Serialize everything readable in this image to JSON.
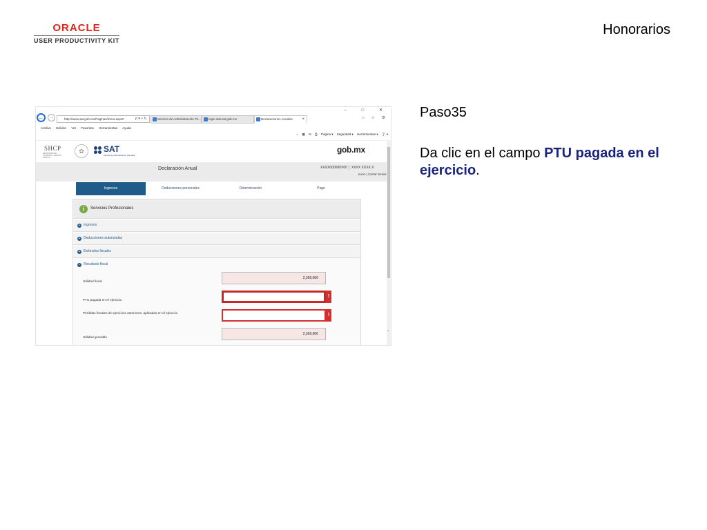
{
  "header": {
    "brand": "ORACLE",
    "brand_sub": "USER PRODUCTIVITY KIT",
    "title": "Honorarios"
  },
  "instruction": {
    "step": "Paso35",
    "prefix": "Da clic en el campo ",
    "highlight": "PTU pagada en el ejercicio",
    "suffix": "."
  },
  "browser": {
    "address": "http://www.sat.gob.mx/Paginas/Inicio.aspx#",
    "address_controls": "ρ ▾ » ↻",
    "tabs": [
      {
        "label": "Servicio de Administración Tri...",
        "active": false
      },
      {
        "label": "login.siat.sat.gob.mx",
        "active": false
      },
      {
        "label": "Declaraciones Anuales",
        "active": true
      }
    ],
    "window_controls": "– □ ✕",
    "menu": [
      "Archivo",
      "Edición",
      "Ver",
      "Favoritos",
      "Herramientas",
      "Ayuda"
    ],
    "commands": [
      "Página ▾",
      "Seguridad ▾",
      "Herramientas ▾",
      "❓ ▾"
    ]
  },
  "site": {
    "shcp": "SHCP",
    "shcp_sub": "SECRETARÍA DE HACIENDA Y CRÉDITO PÚBLICO",
    "sat": "SAT",
    "sat_sub": "Servicio de Administración Tributaria",
    "gobmx": "gob.mx",
    "declaration_title": "Declaración Anual",
    "rfc": "XXXX000000X00 │ XXXX XXXX X",
    "session_links": "Inicio | Cerrar Sesión"
  },
  "tabs": [
    {
      "label": "Ingresos",
      "active": true
    },
    {
      "label": "Deducciones personales",
      "active": false
    },
    {
      "label": "Determinación",
      "active": false
    },
    {
      "label": "Pago",
      "active": false
    }
  ],
  "form": {
    "panel_title": "Servicios Profesionales",
    "sections": [
      "Ingresos",
      "Deducciones autorizadas",
      "Estímulos fiscales",
      "Resultado fiscal"
    ],
    "rows": [
      {
        "label": "Utilidad fiscal",
        "value": "2,369,000",
        "state": "readonly"
      },
      {
        "label": "PTU pagada en el ejercicio",
        "value": "",
        "state": "error-focus"
      },
      {
        "label": "Pérdidas fiscales de ejercicios anteriores, aplicadas en el ejercicio",
        "value": "",
        "state": "error"
      },
      {
        "label": "Utilidad gravable",
        "value": "2,369,000",
        "state": "readonly"
      }
    ],
    "error_mark": "!"
  },
  "colors": {
    "oracle_red": "#e2231a",
    "tab_active": "#1f5c8a",
    "error_red": "#d32f2f",
    "instruction_highlight": "#1a237e"
  }
}
